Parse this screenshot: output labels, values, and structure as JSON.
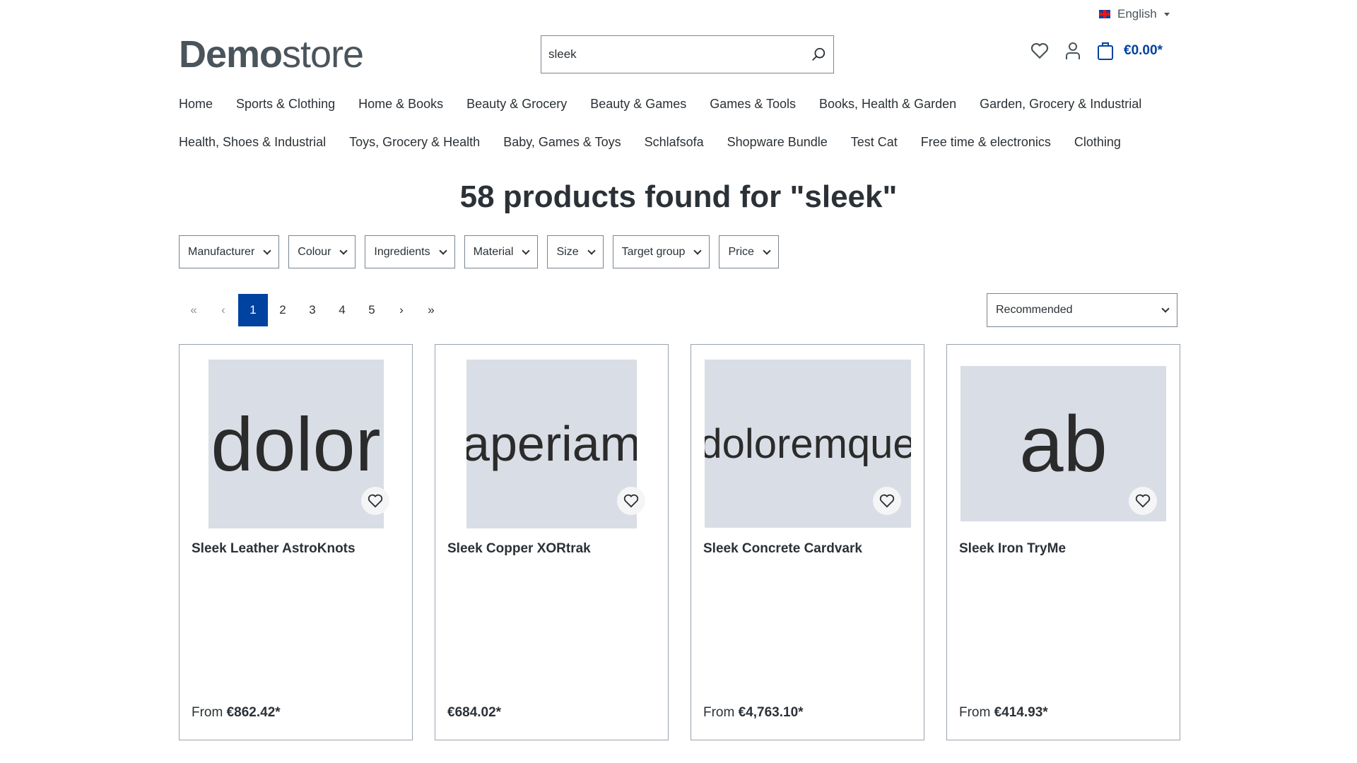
{
  "header": {
    "language": "English",
    "logo_bold": "Demo",
    "logo_light": "store",
    "search_value": "sleek",
    "cart_total": "€0.00*"
  },
  "nav": {
    "row1": [
      "Home",
      "Sports & Clothing",
      "Home & Books",
      "Beauty & Grocery",
      "Beauty & Games",
      "Games & Tools",
      "Books, Health & Garden",
      "Garden, Grocery & Industrial"
    ],
    "row2": [
      "Health, Shoes & Industrial",
      "Toys, Grocery & Health",
      "Baby, Games & Toys",
      "Schlafsofa",
      "Shopware Bundle",
      "Test Cat",
      "Free time & electronics",
      "Clothing"
    ]
  },
  "results": {
    "title": "58 products found for \"sleek\""
  },
  "filters": [
    "Manufacturer",
    "Colour",
    "Ingredients",
    "Material",
    "Size",
    "Target group",
    "Price"
  ],
  "pagination": {
    "first": "«",
    "prev": "‹",
    "pages": [
      "1",
      "2",
      "3",
      "4",
      "5"
    ],
    "active": "1",
    "next": "›",
    "last": "»"
  },
  "sort": {
    "selected": "Recommended"
  },
  "accent_color": "#0042a0",
  "products": [
    {
      "image_text": "dolor",
      "name": "Sleek Leather AstroKnots",
      "price_prefix": "From",
      "price": "€862.42*"
    },
    {
      "image_text": "aperiam",
      "name": "Sleek Copper XORtrak",
      "price_prefix": "",
      "price": "€684.02*"
    },
    {
      "image_text": "doloremque",
      "name": "Sleek Concrete Cardvark",
      "price_prefix": "From",
      "price": "€4,763.10*"
    },
    {
      "image_text": "ab",
      "name": "Sleek Iron TryMe",
      "price_prefix": "From",
      "price": "€414.93*"
    }
  ]
}
